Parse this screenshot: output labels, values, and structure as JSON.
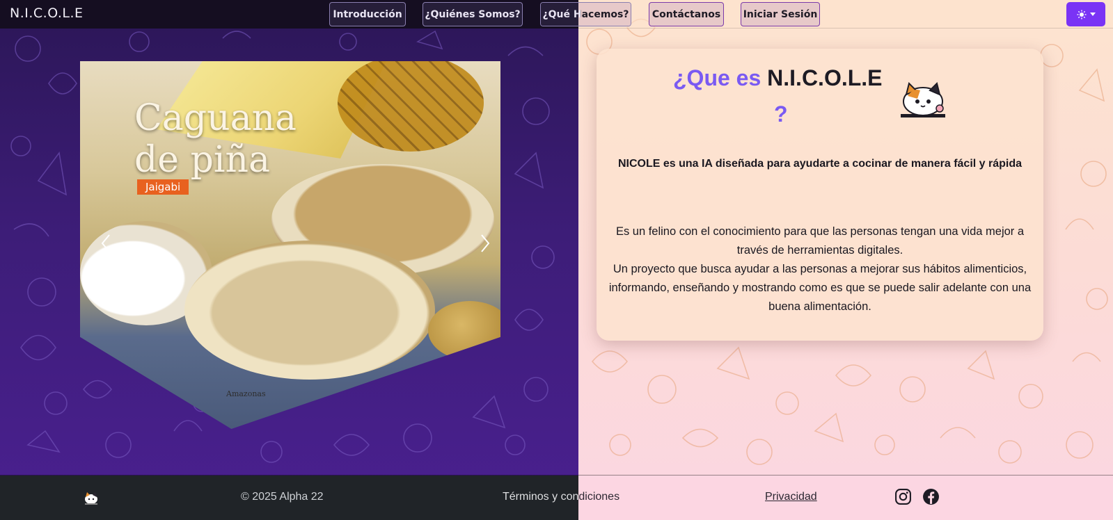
{
  "navbar": {
    "brand": "N.I.C.O.L.E",
    "links": [
      "Introducción",
      "¿Quiénes Somos?",
      "¿Qué Hacemos?",
      "Contáctanos",
      "Iniciar Sesión"
    ],
    "theme_icon": "sun-icon",
    "accent": "#7a33f5"
  },
  "carousel": {
    "title_line1": "Caguana",
    "title_line2": "de piña",
    "tag": "Jaigabi",
    "caption": "Amazonas",
    "prev_icon": "chevron-left-icon",
    "next_icon": "chevron-right-icon"
  },
  "card": {
    "title_prefix": "¿Que es",
    "title_name": "N.I.C.O.L.E",
    "title_suffix": "?",
    "lead": "NICOLE es una IA diseñada para ayudarte a cocinar de manera fácil y rápida",
    "body_line1": "Es un felino con el conocimiento para que las personas tengan una vida mejor a través de herramientas digitales.",
    "body_line2": "Un proyecto que busca ayudar a las personas a mejorar sus hábitos alimenticios, informando, enseñando y mostrando como es que se puede salir adelante con una buena alimentación.",
    "accent": "#7a5af2"
  },
  "footer": {
    "copyright": "© 2025 Alpha 22",
    "terms": "Términos y condiciones",
    "privacy": "Privacidad",
    "icons": [
      "cat-logo-icon",
      "instagram-icon",
      "facebook-icon"
    ]
  }
}
